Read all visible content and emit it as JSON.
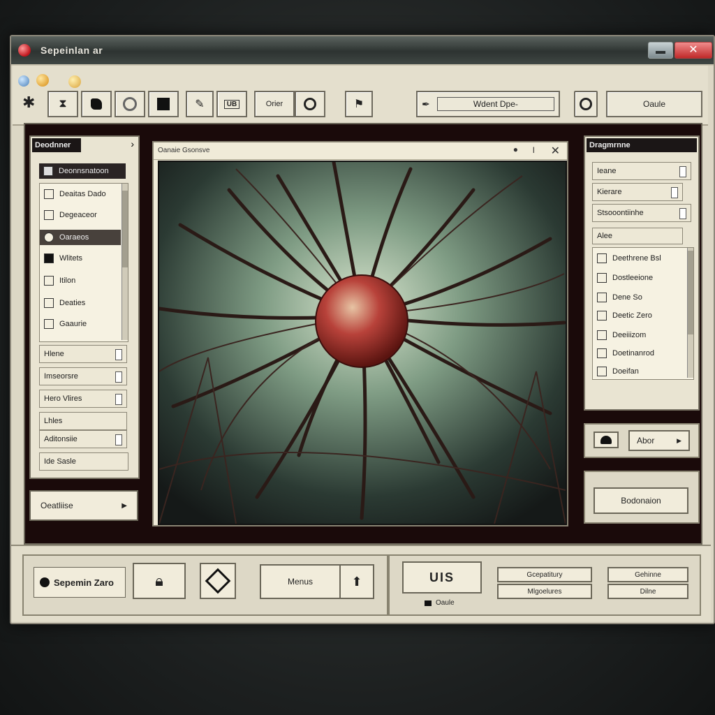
{
  "window": {
    "title": "Sepeinlan ar"
  },
  "toolbar": {
    "search_field": "Wdent Dpe-",
    "right_button": "Oaule",
    "middle_button": "Orier",
    "small_icon": "UB"
  },
  "left_panel": {
    "header": "Deodnner",
    "selected": "Deonnsnatoon",
    "items": [
      {
        "label": "Deaitas Dado",
        "icon": "document-icon"
      },
      {
        "label": "Degeaceor",
        "icon": "grid-icon"
      },
      {
        "label": "Oaraeos",
        "icon": "circle-icon"
      },
      {
        "label": "Wlitets",
        "icon": "square-icon"
      },
      {
        "label": "Itilon",
        "icon": "grid-icon"
      },
      {
        "label": "Deaties",
        "icon": "grid-icon"
      },
      {
        "label": "Gaaurie",
        "icon": "image-icon"
      }
    ],
    "options": [
      "Hlene",
      "Imseorsre",
      "Hero Vlires",
      "Lhles",
      "Aditonsiie",
      "Ide Sasle"
    ],
    "bottom_button": "Oeatliise"
  },
  "canvas": {
    "title": "Oanaie Gsonsve",
    "controls": {
      "dot": "●",
      "bar": "I",
      "close": "✕"
    }
  },
  "right_panel": {
    "header": "Dragmrnne",
    "fields": [
      "Ieane",
      "Kierare",
      "Stsooontiinhe"
    ],
    "list_header": "Alee",
    "items": [
      "Deethrene Bsl",
      "Dostleeione",
      "Dene So",
      "Deetic Zero",
      "Deeiiizom",
      "Doetinanrod",
      "Doeifan"
    ],
    "small_button": "Abor",
    "big_button": "Bodonaion"
  },
  "bottom": {
    "brand": "Sepemin Zaro",
    "menus": "Menus",
    "uis": "UIS",
    "oaule": "Oaule",
    "g1": "Gcepatitury",
    "g2": "Mlgoelures",
    "g3": "Gehinne",
    "g4": "Dilne"
  },
  "colors": {
    "accent_red": "#c0141c",
    "panel_dark": "#1b1616",
    "chrome": "#dcd7c5"
  }
}
